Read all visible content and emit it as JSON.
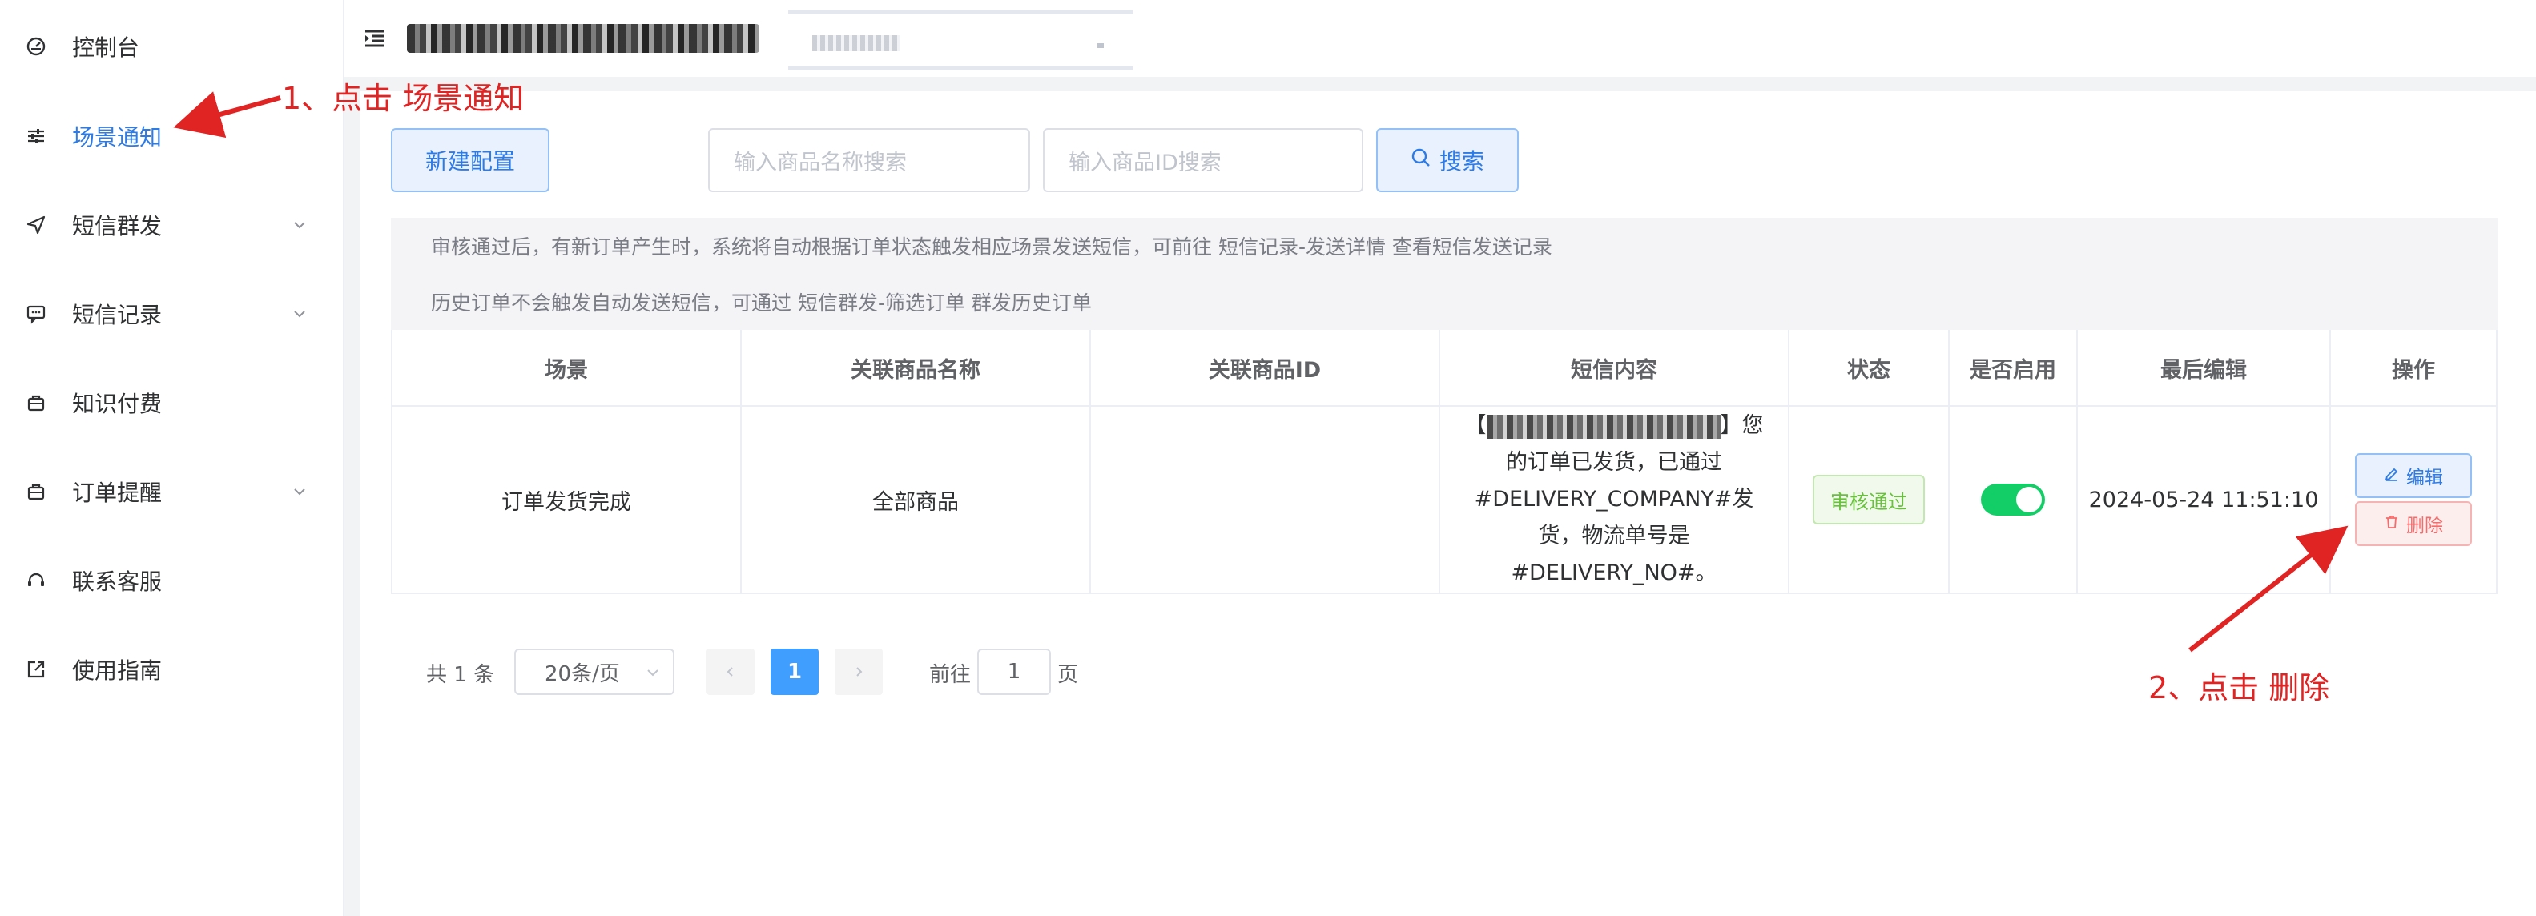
{
  "sidebar": {
    "items": [
      {
        "label": "控制台",
        "icon": "dashboard-icon"
      },
      {
        "label": "场景通知",
        "icon": "sliders-icon",
        "active": true
      },
      {
        "label": "短信群发",
        "icon": "send-icon",
        "expandable": true
      },
      {
        "label": "短信记录",
        "icon": "message-icon",
        "expandable": true
      },
      {
        "label": "知识付费",
        "icon": "briefcase-icon"
      },
      {
        "label": "订单提醒",
        "icon": "briefcase-icon",
        "expandable": true
      },
      {
        "label": "联系客服",
        "icon": "headset-icon"
      },
      {
        "label": "使用指南",
        "icon": "external-link-icon"
      }
    ]
  },
  "toolbar": {
    "new_label": "新建配置",
    "search_label": "搜索",
    "name_placeholder": "输入商品名称搜索",
    "id_placeholder": "输入商品ID搜索"
  },
  "notices": {
    "line1": "审核通过后，有新订单产生时，系统将自动根据订单状态触发相应场景发送短信，可前往 短信记录-发送详情 查看短信发送记录",
    "line2": "历史订单不会触发自动发送短信，可通过 短信群发-筛选订单 群发历史订单"
  },
  "table": {
    "headers": [
      "场景",
      "关联商品名称",
      "关联商品ID",
      "短信内容",
      "状态",
      "是否启用",
      "最后编辑",
      "操作"
    ],
    "rows": [
      {
        "scene": "订单发货完成",
        "product_name": "全部商品",
        "product_id": "",
        "sms_prefix": "【",
        "sms_suffix": "】您的订单已发货，已通过#DELIVERY_COMPANY#发货，物流单号是#DELIVERY_NO#。",
        "status": "审核通过",
        "enabled": true,
        "last_edit": "2024-05-24 11:51:10",
        "edit_label": "编辑",
        "delete_label": "删除"
      }
    ]
  },
  "pagination": {
    "total": "共 1 条",
    "page_size": "20条/页",
    "current_page": "1",
    "goto_label": "前往",
    "goto_value": "1",
    "page_unit": "页"
  },
  "annotations": {
    "step1": "1、点击 场景通知",
    "step2": "2、点击 删除"
  },
  "colors": {
    "primary": "#2d7be6",
    "success": "#13ce66",
    "danger": "#f56c6c",
    "annotation": "#e02424"
  }
}
